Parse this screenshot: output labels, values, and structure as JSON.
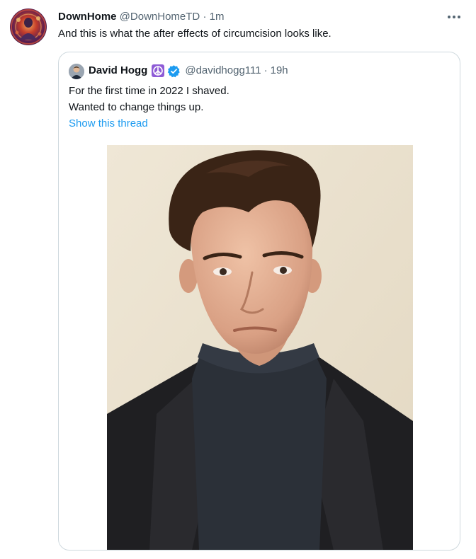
{
  "tweet": {
    "author_name": "DownHome",
    "author_handle": "@DownHomeTD",
    "separator": "·",
    "time": "1m",
    "text": "And this is what the after effects of circumcision looks like."
  },
  "quoted_tweet": {
    "author_name": "David Hogg",
    "author_handle": "@davidhogg111",
    "separator": "·",
    "time": "19h",
    "text_lines": [
      "For the first time in 2022 I shaved.",
      "Wanted to change things up."
    ],
    "show_thread": "Show this thread"
  },
  "icons": {
    "more": "more-horizontal-icon",
    "peace": "peace-symbol-icon",
    "verified": "verified-badge-icon"
  },
  "colors": {
    "link": "#1d9bf0",
    "muted_text": "#536471",
    "border": "#cfd9de",
    "peace_badge": "#8e5bd6"
  }
}
